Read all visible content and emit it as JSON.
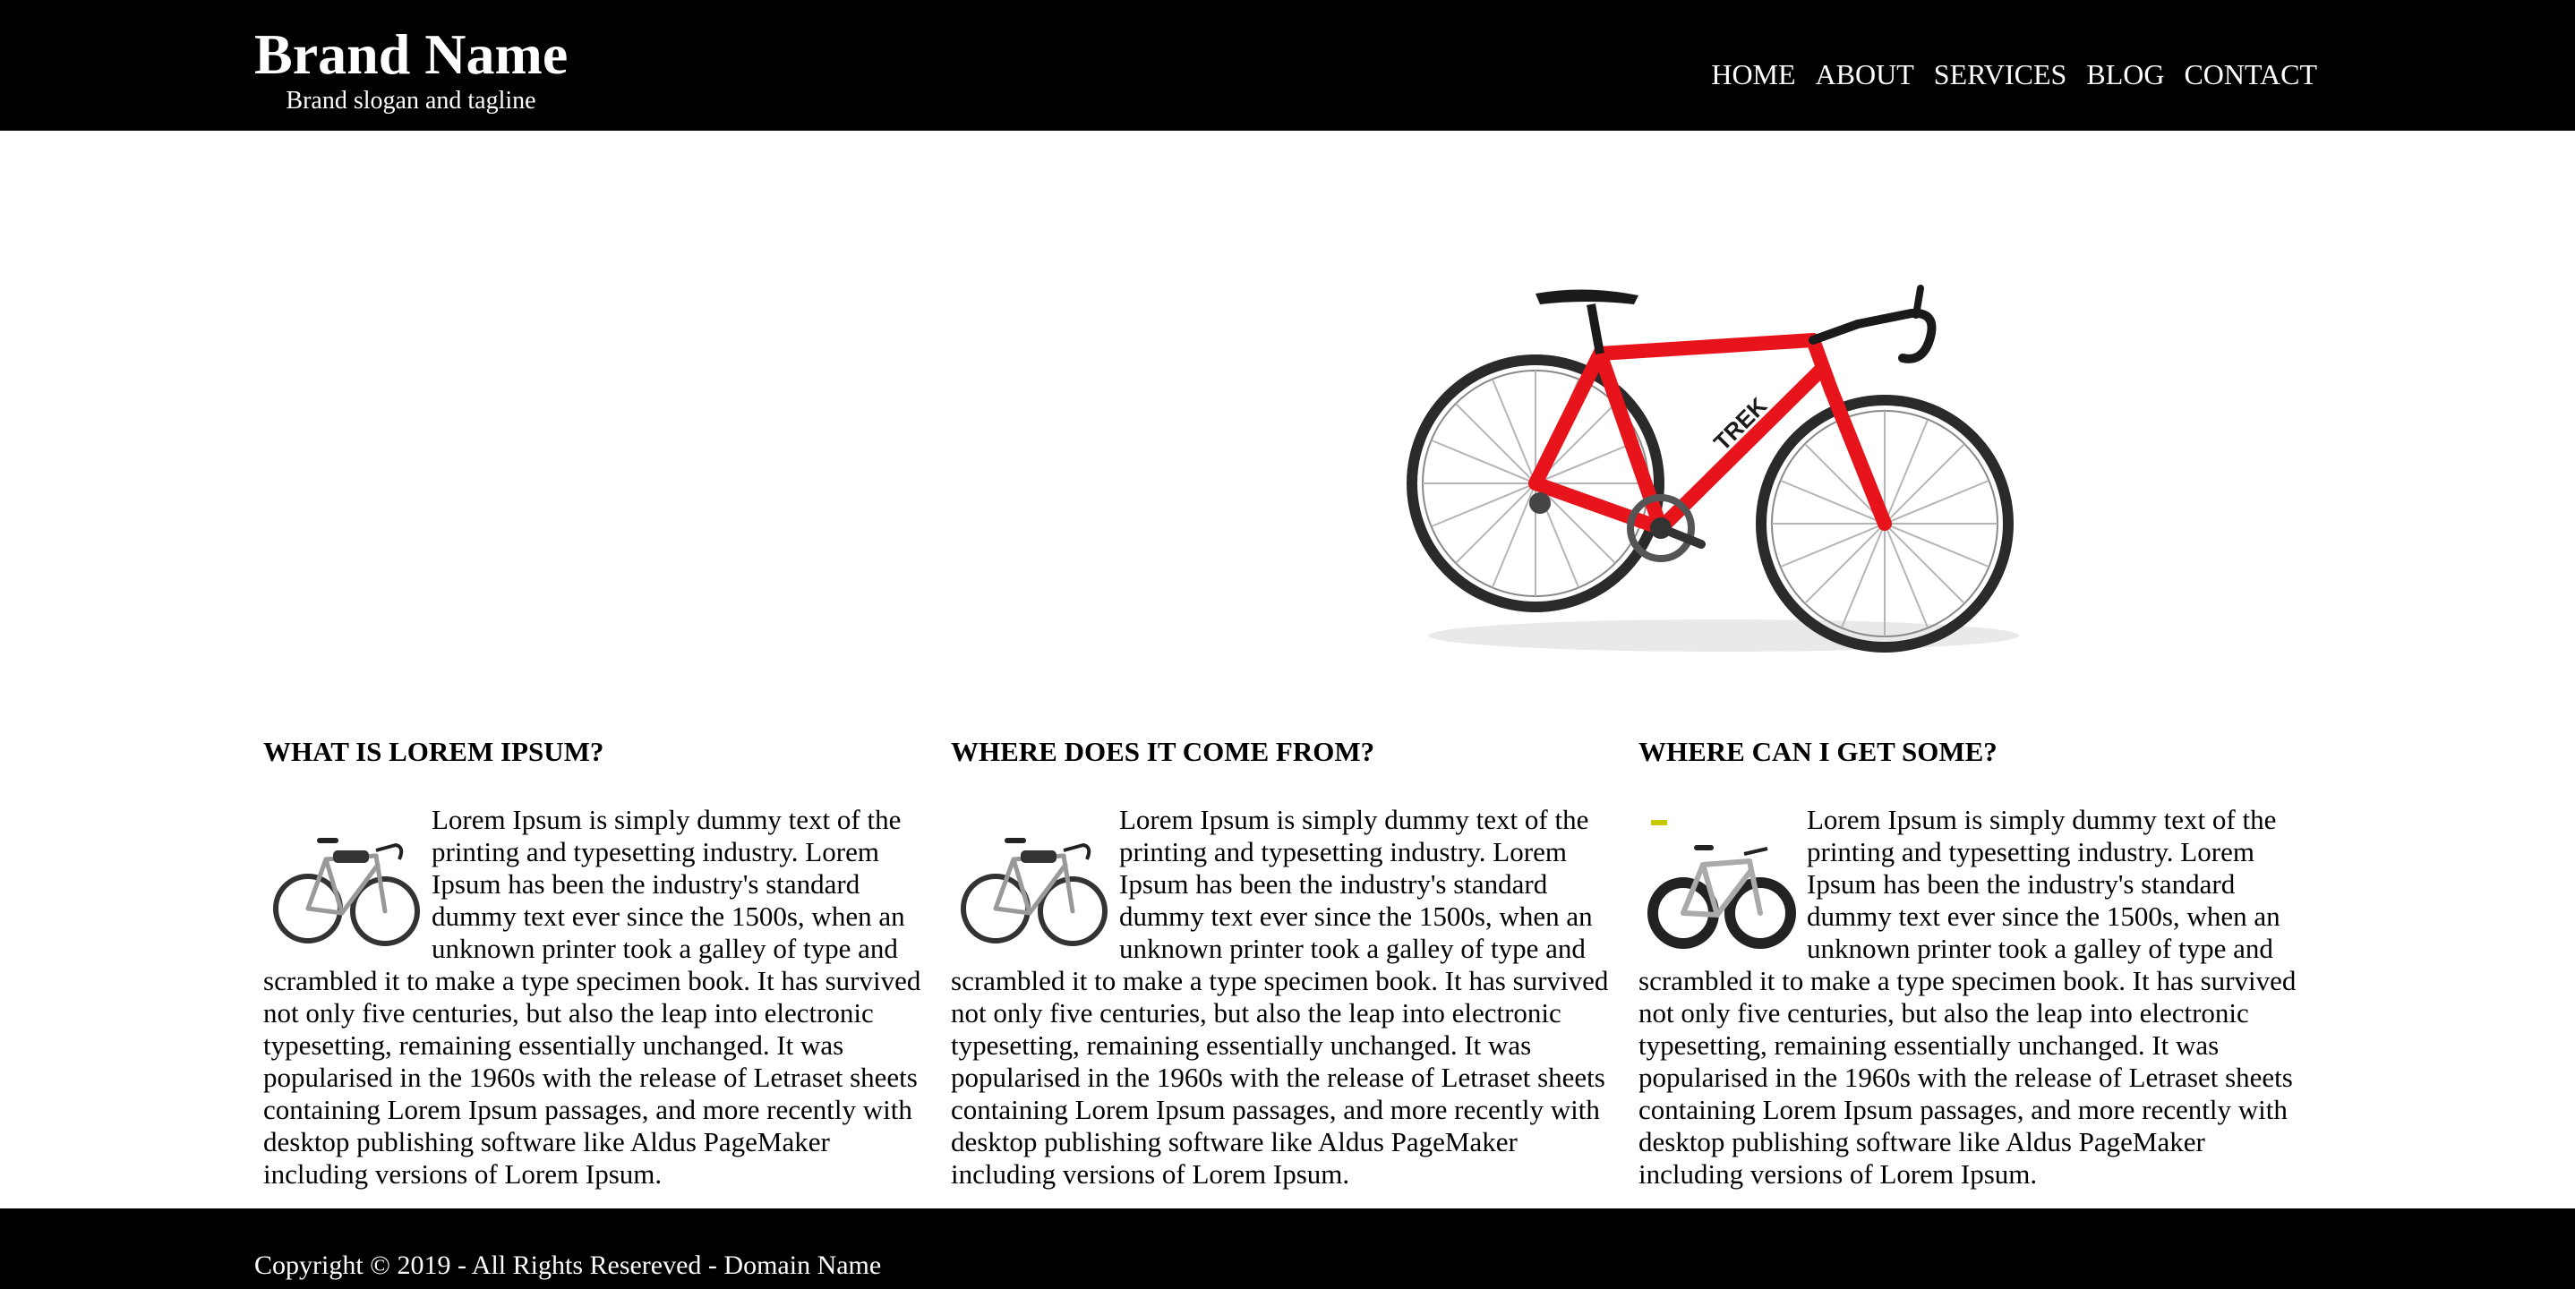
{
  "header": {
    "brand_name": "Brand Name",
    "slogan": "Brand slogan and tagline",
    "nav": [
      {
        "label": "HOME"
      },
      {
        "label": "ABOUT"
      },
      {
        "label": "SERVICES"
      },
      {
        "label": "BLOG"
      },
      {
        "label": "CONTACT"
      }
    ]
  },
  "hero": {
    "image": "road-bicycle-red-image"
  },
  "columns": [
    {
      "title": "WHAT IS LOREM IPSUM?",
      "thumbnail": "gravel-bicycle-thumbnail",
      "body": "Lorem Ipsum is simply dummy text of the printing and typesetting industry. Lorem Ipsum has been the industry's standard dummy text ever since the 1500s, when an unknown printer took a galley of type and scrambled it to make a type specimen book. It has survived not only five centuries, but also the leap into electronic typesetting, remaining essentially unchanged. It was popularised in the 1960s with the release of Letraset sheets containing Lorem Ipsum passages, and more recently with desktop publishing software like Aldus PageMaker including versions of Lorem Ipsum."
    },
    {
      "title": "WHERE DOES IT COME FROM?",
      "thumbnail": "gravel-bicycle-thumbnail",
      "body": "Lorem Ipsum is simply dummy text of the printing and typesetting industry. Lorem Ipsum has been the industry's standard dummy text ever since the 1500s, when an unknown printer took a galley of type and scrambled it to make a type specimen book. It has survived not only five centuries, but also the leap into electronic typesetting, remaining essentially unchanged. It was popularised in the 1960s with the release of Letraset sheets containing Lorem Ipsum passages, and more recently with desktop publishing software like Aldus PageMaker including versions of Lorem Ipsum."
    },
    {
      "title": "WHERE CAN I GET SOME?",
      "thumbnail": "fat-tire-bicycle-thumbnail",
      "body": "Lorem Ipsum is simply dummy text of the printing and typesetting industry. Lorem Ipsum has been the industry's standard dummy text ever since the 1500s, when an unknown printer took a galley of type and scrambled it to make a type specimen book. It has survived not only five centuries, but also the leap into electronic typesetting, remaining essentially unchanged. It was popularised in the 1960s with the release of Letraset sheets containing Lorem Ipsum passages, and more recently with desktop publishing software like Aldus PageMaker including versions of Lorem Ipsum."
    }
  ],
  "footer": {
    "copyright": "Copyright © 2019 - All Rights Resereved - Domain Name"
  },
  "colors": {
    "header_bg": "#000000",
    "footer_bg": "#000000",
    "page_bg": "#ffffff",
    "bike_red": "#e8141c"
  }
}
